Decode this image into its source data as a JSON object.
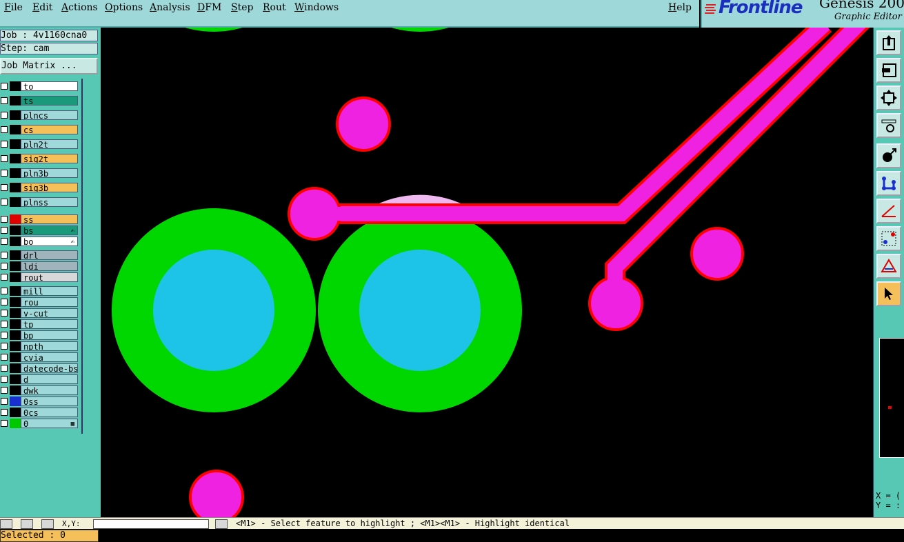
{
  "menubar": {
    "items": [
      "File",
      "Edit",
      "Actions",
      "Options",
      "Analysis",
      "DFM",
      "Step",
      "Rout",
      "Windows"
    ],
    "help": "Help"
  },
  "brand": {
    "logo": "Frontline",
    "product": "Genesis 200",
    "subtitle": "Graphic Editor"
  },
  "info": {
    "job": "Job : 4v1160cna0",
    "step": "Step: cam",
    "job_matrix": "Job Matrix ..."
  },
  "layers": [
    {
      "name": "to",
      "color": "#ffffff",
      "swatch": "#000000"
    },
    {
      "name": "ts",
      "color": "#1a9a7a",
      "swatch": "#000000"
    },
    {
      "name": "plncs",
      "color": "#9fd8d8",
      "swatch": "#000000"
    },
    {
      "name": "cs",
      "color": "#f5c05a",
      "swatch": "#000000"
    },
    {
      "name": "pln2t",
      "color": "#9fd8d8",
      "swatch": "#000000"
    },
    {
      "name": "sig2t",
      "color": "#f5c05a",
      "swatch": "#000000"
    },
    {
      "name": "pln3b",
      "color": "#9fd8d8",
      "swatch": "#000000"
    },
    {
      "name": "sig3b",
      "color": "#f5c05a",
      "swatch": "#000000"
    },
    {
      "name": "plnss",
      "color": "#9fd8d8",
      "swatch": "#000000"
    },
    {
      "name": "ss",
      "color": "#f5c05a",
      "swatch": "#e00000"
    },
    {
      "name": "bs",
      "color": "#1a9a7a",
      "swatch": "#000000",
      "mark": "✍"
    },
    {
      "name": "bo",
      "color": "#ffffff",
      "swatch": "#000000",
      "mark": "✍"
    },
    {
      "name": "drl",
      "color": "#a0b4bc",
      "swatch": "#000000"
    },
    {
      "name": "ldi",
      "color": "#a0b4bc",
      "swatch": "#000000"
    },
    {
      "name": "rout",
      "color": "#d8d8d8",
      "swatch": "#000000"
    },
    {
      "name": "mill",
      "color": "#9fd8d8",
      "swatch": "#000000"
    },
    {
      "name": "rou",
      "color": "#9fd8d8",
      "swatch": "#000000"
    },
    {
      "name": "v-cut",
      "color": "#9fd8d8",
      "swatch": "#000000"
    },
    {
      "name": "tp",
      "color": "#9fd8d8",
      "swatch": "#000000"
    },
    {
      "name": "bp",
      "color": "#9fd8d8",
      "swatch": "#000000"
    },
    {
      "name": "npth",
      "color": "#9fd8d8",
      "swatch": "#000000"
    },
    {
      "name": "cvia",
      "color": "#9fd8d8",
      "swatch": "#000000"
    },
    {
      "name": "datecode-bs",
      "color": "#9fd8d8",
      "swatch": "#000000"
    },
    {
      "name": "d",
      "color": "#9fd8d8",
      "swatch": "#000000"
    },
    {
      "name": "dwk",
      "color": "#9fd8d8",
      "swatch": "#000000"
    },
    {
      "name": "0ss",
      "color": "#9fd8d8",
      "swatch": "#1a2fd0"
    },
    {
      "name": "0cs",
      "color": "#9fd8d8",
      "swatch": "#000000"
    },
    {
      "name": "0",
      "color": "#9fd8d8",
      "swatch": "#00c800",
      "mark": "▦"
    }
  ],
  "selected": "Selected : 0",
  "coords": {
    "x_label": "X = (",
    "y_label": "Y = :"
  },
  "status": {
    "xy": "X,Y:",
    "message": "<M1> - Select feature to highlight ; <M1><M1> - Highlight identical"
  },
  "tools": [
    "zoom-home-icon",
    "zoom-back-icon",
    "fit-screen-icon",
    "measure-icon",
    "snap-icon",
    "net-icon",
    "angle-icon",
    "select-region-icon",
    "triangle-icon",
    "pointer-icon"
  ],
  "colors": {
    "pad_fill": "#ee22e0",
    "pad_outline": "#ff0000",
    "ring": "#00d700",
    "hole": "#1dc4e8",
    "background": "#000000",
    "highlight": "#f0b8f0"
  }
}
